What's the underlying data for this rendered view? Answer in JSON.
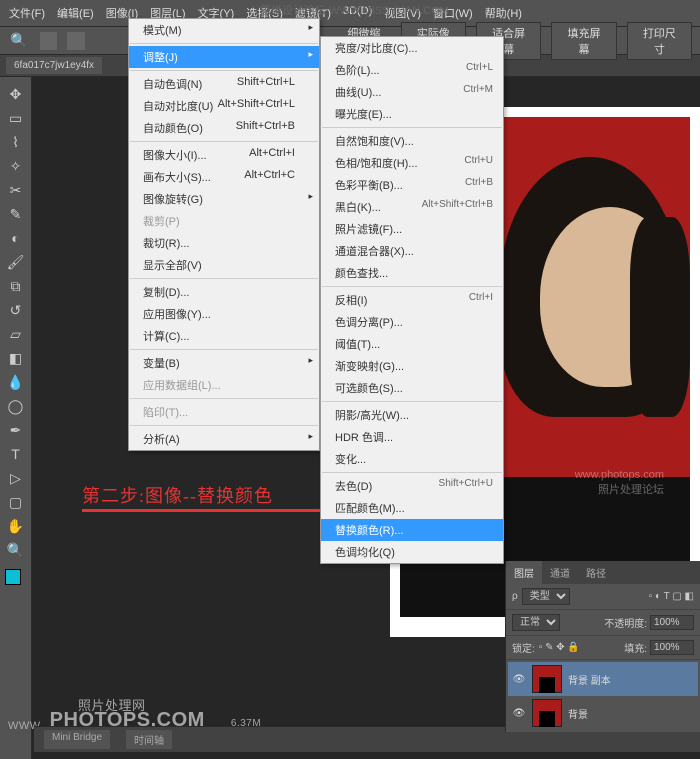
{
  "top_wm": "思缘设计论坛  WWW.MISSYUAN.COM",
  "menubar": [
    "文件(F)",
    "编辑(E)",
    "图像(I)",
    "图层(L)",
    "文字(Y)",
    "选择(S)",
    "滤镜(T)",
    "3D(D)",
    "视图(V)",
    "窗口(W)",
    "帮助(H)"
  ],
  "options": {
    "scale_zoom": "细微缩放",
    "actual_pixels": "实际像素",
    "fit_screen": "适合屏幕",
    "fill_screen": "填充屏幕",
    "print_size": "打印尺寸"
  },
  "tab_title": "6fa017c7jw1ey4fx",
  "menu_image": [
    {
      "label": "模式(M)",
      "sub": true
    },
    {
      "label": "调整(J)",
      "sel": true,
      "sub": true
    },
    {
      "label": "自动色调(N)",
      "sc": "Shift+Ctrl+L"
    },
    {
      "label": "自动对比度(U)",
      "sc": "Alt+Shift+Ctrl+L"
    },
    {
      "label": "自动颜色(O)",
      "sc": "Shift+Ctrl+B"
    },
    {
      "label": "图像大小(I)...",
      "sc": "Alt+Ctrl+I"
    },
    {
      "label": "画布大小(S)...",
      "sc": "Alt+Ctrl+C"
    },
    {
      "label": "图像旋转(G)",
      "sub": true
    },
    {
      "label": "裁剪(P)",
      "dis": true
    },
    {
      "label": "裁切(R)..."
    },
    {
      "label": "显示全部(V)"
    },
    {
      "label": "复制(D)..."
    },
    {
      "label": "应用图像(Y)..."
    },
    {
      "label": "计算(C)..."
    },
    {
      "label": "变量(B)",
      "sub": true
    },
    {
      "label": "应用数据组(L)...",
      "dis": true
    },
    {
      "label": "陷印(T)...",
      "dis": true
    },
    {
      "label": "分析(A)",
      "sub": true
    }
  ],
  "menu_adjust": [
    {
      "label": "亮度/对比度(C)..."
    },
    {
      "label": "色阶(L)...",
      "sc": "Ctrl+L"
    },
    {
      "label": "曲线(U)...",
      "sc": "Ctrl+M"
    },
    {
      "label": "曝光度(E)..."
    },
    {
      "label": "自然饱和度(V)..."
    },
    {
      "label": "色相/饱和度(H)...",
      "sc": "Ctrl+U"
    },
    {
      "label": "色彩平衡(B)...",
      "sc": "Ctrl+B"
    },
    {
      "label": "黑白(K)...",
      "sc": "Alt+Shift+Ctrl+B"
    },
    {
      "label": "照片滤镜(F)..."
    },
    {
      "label": "通道混合器(X)..."
    },
    {
      "label": "颜色查找..."
    },
    {
      "label": "反相(I)",
      "sc": "Ctrl+I"
    },
    {
      "label": "色调分离(P)..."
    },
    {
      "label": "阈值(T)..."
    },
    {
      "label": "渐变映射(G)..."
    },
    {
      "label": "可选颜色(S)..."
    },
    {
      "label": "阴影/高光(W)..."
    },
    {
      "label": "HDR 色调..."
    },
    {
      "label": "变化..."
    },
    {
      "label": "去色(D)",
      "sc": "Shift+Ctrl+U"
    },
    {
      "label": "匹配颜色(M)..."
    },
    {
      "label": "替换颜色(R)...",
      "sel": true
    },
    {
      "label": "色调均化(Q)"
    }
  ],
  "annotation": "第二步:图像--替换颜色",
  "panels": {
    "tabs": [
      "图层",
      "通道",
      "路径"
    ],
    "kind": "类型",
    "blend": "正常",
    "opacity_label": "不透明度:",
    "opacity": "100%",
    "lock_label": "锁定:",
    "fill_label": "填充:",
    "fill": "100%",
    "layers": [
      {
        "name": "背景 副本",
        "sel": true
      },
      {
        "name": "背景"
      }
    ]
  },
  "wm2_site": "www.photops.com",
  "wm2_text": "照片处理论坛",
  "watermark_site": "WWW.",
  "watermark": "PHOTOPS.COM",
  "watermark_sub": "照片处理网",
  "status_info": "6.37M",
  "status_tabs": [
    "Mini Bridge",
    "时间轴"
  ]
}
